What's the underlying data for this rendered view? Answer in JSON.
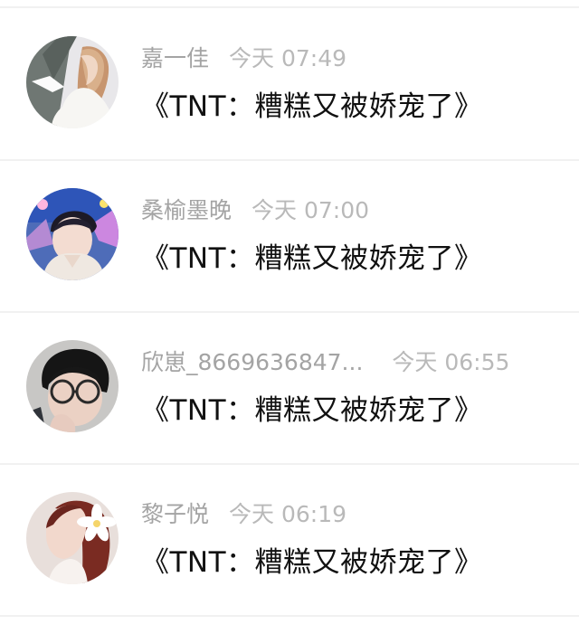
{
  "comments": [
    {
      "user": "嘉一佳",
      "time": "今天 07:49",
      "text": "《TNT：糟糕又被娇宠了》"
    },
    {
      "user": "桑榆墨晚",
      "time": "今天 07:00",
      "text": "《TNT：糟糕又被娇宠了》"
    },
    {
      "user": "欣崽_8669636847...",
      "time": "今天 06:55",
      "text": "《TNT：糟糕又被娇宠了》"
    },
    {
      "user": "黎子悦",
      "time": "今天 06:19",
      "text": "《TNT：糟糕又被娇宠了》"
    }
  ]
}
